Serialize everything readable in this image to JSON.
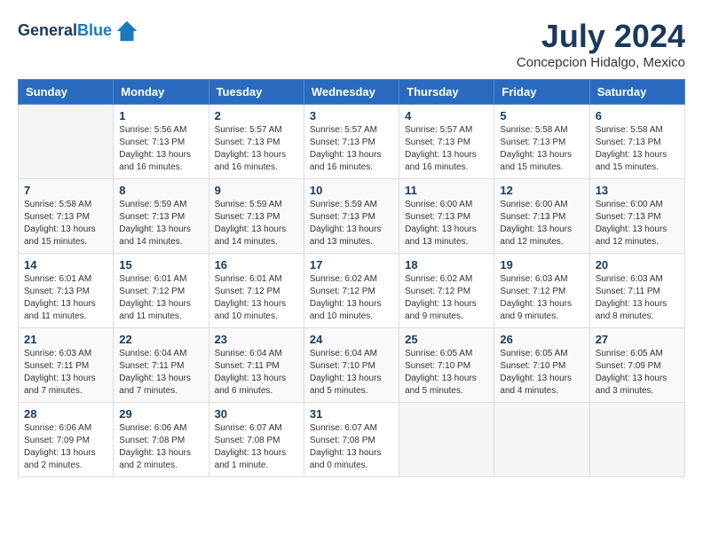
{
  "header": {
    "logo_line1": "General",
    "logo_line2": "Blue",
    "month_title": "July 2024",
    "location": "Concepcion Hidalgo, Mexico"
  },
  "weekdays": [
    "Sunday",
    "Monday",
    "Tuesday",
    "Wednesday",
    "Thursday",
    "Friday",
    "Saturday"
  ],
  "weeks": [
    [
      {
        "day": "",
        "sunrise": "",
        "sunset": "",
        "daylight": ""
      },
      {
        "day": "1",
        "sunrise": "Sunrise: 5:56 AM",
        "sunset": "Sunset: 7:13 PM",
        "daylight": "Daylight: 13 hours and 16 minutes."
      },
      {
        "day": "2",
        "sunrise": "Sunrise: 5:57 AM",
        "sunset": "Sunset: 7:13 PM",
        "daylight": "Daylight: 13 hours and 16 minutes."
      },
      {
        "day": "3",
        "sunrise": "Sunrise: 5:57 AM",
        "sunset": "Sunset: 7:13 PM",
        "daylight": "Daylight: 13 hours and 16 minutes."
      },
      {
        "day": "4",
        "sunrise": "Sunrise: 5:57 AM",
        "sunset": "Sunset: 7:13 PM",
        "daylight": "Daylight: 13 hours and 16 minutes."
      },
      {
        "day": "5",
        "sunrise": "Sunrise: 5:58 AM",
        "sunset": "Sunset: 7:13 PM",
        "daylight": "Daylight: 13 hours and 15 minutes."
      },
      {
        "day": "6",
        "sunrise": "Sunrise: 5:58 AM",
        "sunset": "Sunset: 7:13 PM",
        "daylight": "Daylight: 13 hours and 15 minutes."
      }
    ],
    [
      {
        "day": "7",
        "sunrise": "Sunrise: 5:58 AM",
        "sunset": "Sunset: 7:13 PM",
        "daylight": "Daylight: 13 hours and 15 minutes."
      },
      {
        "day": "8",
        "sunrise": "Sunrise: 5:59 AM",
        "sunset": "Sunset: 7:13 PM",
        "daylight": "Daylight: 13 hours and 14 minutes."
      },
      {
        "day": "9",
        "sunrise": "Sunrise: 5:59 AM",
        "sunset": "Sunset: 7:13 PM",
        "daylight": "Daylight: 13 hours and 14 minutes."
      },
      {
        "day": "10",
        "sunrise": "Sunrise: 5:59 AM",
        "sunset": "Sunset: 7:13 PM",
        "daylight": "Daylight: 13 hours and 13 minutes."
      },
      {
        "day": "11",
        "sunrise": "Sunrise: 6:00 AM",
        "sunset": "Sunset: 7:13 PM",
        "daylight": "Daylight: 13 hours and 13 minutes."
      },
      {
        "day": "12",
        "sunrise": "Sunrise: 6:00 AM",
        "sunset": "Sunset: 7:13 PM",
        "daylight": "Daylight: 13 hours and 12 minutes."
      },
      {
        "day": "13",
        "sunrise": "Sunrise: 6:00 AM",
        "sunset": "Sunset: 7:13 PM",
        "daylight": "Daylight: 13 hours and 12 minutes."
      }
    ],
    [
      {
        "day": "14",
        "sunrise": "Sunrise: 6:01 AM",
        "sunset": "Sunset: 7:13 PM",
        "daylight": "Daylight: 13 hours and 11 minutes."
      },
      {
        "day": "15",
        "sunrise": "Sunrise: 6:01 AM",
        "sunset": "Sunset: 7:12 PM",
        "daylight": "Daylight: 13 hours and 11 minutes."
      },
      {
        "day": "16",
        "sunrise": "Sunrise: 6:01 AM",
        "sunset": "Sunset: 7:12 PM",
        "daylight": "Daylight: 13 hours and 10 minutes."
      },
      {
        "day": "17",
        "sunrise": "Sunrise: 6:02 AM",
        "sunset": "Sunset: 7:12 PM",
        "daylight": "Daylight: 13 hours and 10 minutes."
      },
      {
        "day": "18",
        "sunrise": "Sunrise: 6:02 AM",
        "sunset": "Sunset: 7:12 PM",
        "daylight": "Daylight: 13 hours and 9 minutes."
      },
      {
        "day": "19",
        "sunrise": "Sunrise: 6:03 AM",
        "sunset": "Sunset: 7:12 PM",
        "daylight": "Daylight: 13 hours and 9 minutes."
      },
      {
        "day": "20",
        "sunrise": "Sunrise: 6:03 AM",
        "sunset": "Sunset: 7:11 PM",
        "daylight": "Daylight: 13 hours and 8 minutes."
      }
    ],
    [
      {
        "day": "21",
        "sunrise": "Sunrise: 6:03 AM",
        "sunset": "Sunset: 7:11 PM",
        "daylight": "Daylight: 13 hours and 7 minutes."
      },
      {
        "day": "22",
        "sunrise": "Sunrise: 6:04 AM",
        "sunset": "Sunset: 7:11 PM",
        "daylight": "Daylight: 13 hours and 7 minutes."
      },
      {
        "day": "23",
        "sunrise": "Sunrise: 6:04 AM",
        "sunset": "Sunset: 7:11 PM",
        "daylight": "Daylight: 13 hours and 6 minutes."
      },
      {
        "day": "24",
        "sunrise": "Sunrise: 6:04 AM",
        "sunset": "Sunset: 7:10 PM",
        "daylight": "Daylight: 13 hours and 5 minutes."
      },
      {
        "day": "25",
        "sunrise": "Sunrise: 6:05 AM",
        "sunset": "Sunset: 7:10 PM",
        "daylight": "Daylight: 13 hours and 5 minutes."
      },
      {
        "day": "26",
        "sunrise": "Sunrise: 6:05 AM",
        "sunset": "Sunset: 7:10 PM",
        "daylight": "Daylight: 13 hours and 4 minutes."
      },
      {
        "day": "27",
        "sunrise": "Sunrise: 6:05 AM",
        "sunset": "Sunset: 7:09 PM",
        "daylight": "Daylight: 13 hours and 3 minutes."
      }
    ],
    [
      {
        "day": "28",
        "sunrise": "Sunrise: 6:06 AM",
        "sunset": "Sunset: 7:09 PM",
        "daylight": "Daylight: 13 hours and 2 minutes."
      },
      {
        "day": "29",
        "sunrise": "Sunrise: 6:06 AM",
        "sunset": "Sunset: 7:08 PM",
        "daylight": "Daylight: 13 hours and 2 minutes."
      },
      {
        "day": "30",
        "sunrise": "Sunrise: 6:07 AM",
        "sunset": "Sunset: 7:08 PM",
        "daylight": "Daylight: 13 hours and 1 minute."
      },
      {
        "day": "31",
        "sunrise": "Sunrise: 6:07 AM",
        "sunset": "Sunset: 7:08 PM",
        "daylight": "Daylight: 13 hours and 0 minutes."
      },
      {
        "day": "",
        "sunrise": "",
        "sunset": "",
        "daylight": ""
      },
      {
        "day": "",
        "sunrise": "",
        "sunset": "",
        "daylight": ""
      },
      {
        "day": "",
        "sunrise": "",
        "sunset": "",
        "daylight": ""
      }
    ]
  ]
}
